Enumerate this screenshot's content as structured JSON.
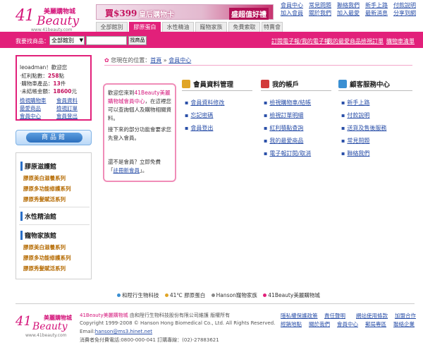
{
  "brand": {
    "logo_num": "41",
    "logo_word": "Beauty",
    "logo_cn": "美麗購物城",
    "logo_url": "www.41beauty.com"
  },
  "banner": {
    "price": "買$399",
    "main": "皇后購物卡",
    "right": "盛超值好禮"
  },
  "top_links": {
    "row1": [
      "會員中心",
      "常見問題",
      "聯絡我們",
      "新手上路",
      "付款說明"
    ],
    "row2": [
      "加入會員",
      "關於我們",
      "加入最愛",
      "最新消息",
      "分享到網"
    ]
  },
  "tabs": [
    "全部館別",
    "膠原蛋白",
    "水性精油",
    "寵物家族",
    "免費索取",
    "特賣會"
  ],
  "active_tab": 1,
  "search": {
    "label": "我要找商品：",
    "select_value": "全部館別",
    "button": "找商品"
  },
  "search_links": [
    "訂閱電子報/我的電子報",
    "我的最愛商品",
    "檢視訂單",
    "購物車清單"
  ],
  "user": {
    "name": "leoadman！歡迎您",
    "points_label": "‧紅利點數：",
    "points": "258",
    "points_unit": "點",
    "buys_label": "‧購物車產品：",
    "buys": "13",
    "buys_unit": "件",
    "unpaid_label": "‧未結帳金額：",
    "unpaid": "18600",
    "unpaid_unit": "元",
    "links": [
      "檢視購物車",
      "會員資料",
      "最愛商品",
      "檢視訂單",
      "會員中心",
      "會員登出"
    ]
  },
  "goods_header": "商品館",
  "categories": [
    {
      "title": "膠原滋護館",
      "items": [
        "膠原美白滋養系列",
        "膠原多功能修護系列",
        "膠原秀髮賦活系列"
      ]
    },
    {
      "title": "水性精油館",
      "items": []
    },
    {
      "title": "寵物家族館",
      "items": [
        "膠原美白滋養系列",
        "膠原多功能修護系列",
        "膠原秀髮賦活系列"
      ]
    }
  ],
  "breadcrumb": {
    "prefix": "您現在的位置：",
    "home": "首頁",
    "sep": " » ",
    "current": "會員中心"
  },
  "welcome": {
    "line1_pre": "歡迎您來到",
    "line1_pink": "41Beauty美麗購物城會員中心",
    "line1_post": "，在這裡您可以查詢個人及購物相關資料。",
    "line2": "接下來的部分功能會要求您先登入會員。",
    "line3": "還不是會員？立即免費",
    "register": "註冊新會員",
    "line3_end": "。"
  },
  "columns": [
    {
      "title": "會員資料管理",
      "icon_color": "#e0a526",
      "items": [
        "會員資料修改",
        "忘記密碼",
        "會員登出"
      ]
    },
    {
      "title": "我的帳戶",
      "icon_color": "#d23a3a",
      "items": [
        "檢視購物車/結帳",
        "檢視訂單明細",
        "紅利積點查詢",
        "我的最愛商品",
        "電子報訂閱/取消"
      ]
    },
    {
      "title": "顧客服務中心",
      "icon_color": "#3a8fd2",
      "items": [
        "新手上路",
        "付款說明",
        "送貨及售後服務",
        "常見問題",
        "聯絡我們"
      ]
    }
  ],
  "brands": [
    {
      "name": "和陞行生物科技",
      "color": "#3a8fd2"
    },
    {
      "name": "41℃ 膠原蛋白",
      "color": "#e0a526"
    },
    {
      "name": "Hanson寵物家族",
      "color": "#888888"
    },
    {
      "name": "41Beauty美麗購物城",
      "color": "#e2207a"
    }
  ],
  "footer": {
    "line1_pink": "41Beauty美麗購物城",
    "line1_rest": "由和陞行生物科技股份有限公司維護 版權所有",
    "line2": "Copyright 1999-2008 © Hanson Hong Biomedical Co., Ltd. All Rights Reserved.",
    "email_label": "Email:",
    "email": "hanson@ms3.hinet.net",
    "line4": "消費者免付費電話:0800-000-041  訂購專線：(02)-27883621",
    "links_row1": [
      "隱私權保護政策",
      "責任聲明",
      "網站使用條款",
      "加盟合作"
    ],
    "links_row2": [
      "經銷地點",
      "關於我們",
      "會員中心",
      "郵局專區",
      "聯絡企業"
    ]
  }
}
